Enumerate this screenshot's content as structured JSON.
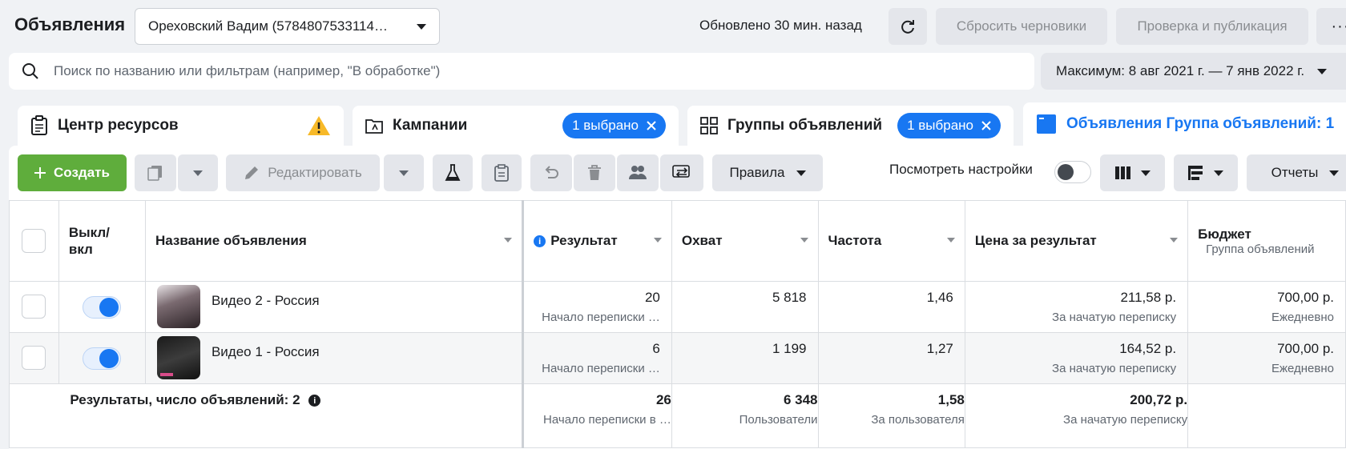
{
  "header": {
    "title": "Объявления",
    "account": "Ореховский Вадим (5784807533114…",
    "updated": "Обновлено 30 мин. назад",
    "reset_label": "Сбросить черновики",
    "publish_label": "Проверка и публикация",
    "more_label": "···"
  },
  "search": {
    "placeholder": "Поиск по названию или фильтрам (например, \"В обработке\")",
    "date_range": "Максимум: 8 авг 2021 г. — 7 янв 2022 г."
  },
  "tabs": [
    {
      "label": "Центр ресурсов"
    },
    {
      "label": "Кампании",
      "chip": "1 выбрано"
    },
    {
      "label": "Группы объявлений",
      "chip": "1 выбрано"
    },
    {
      "label": "Объявления Группа объявлений: 1"
    }
  ],
  "toolbar": {
    "create_label": "Создать",
    "edit_label": "Редактировать",
    "rules_label": "Правила",
    "view_settings_label": "Посмотреть настройки",
    "reports_label": "Отчеты"
  },
  "table": {
    "columns": {
      "toggle": "Выкл/ вкл",
      "name": "Название объявления",
      "result": "Результат",
      "reach": "Охват",
      "frequency": "Частота",
      "cost_per_result": "Цена за результат",
      "budget": "Бюджет",
      "budget_sub": "Группа объявлений"
    },
    "rows": [
      {
        "name": "Видео 2 - Россия",
        "result": "20",
        "result_sub": "Начало переписки …",
        "reach": "5 818",
        "frequency": "1,46",
        "cost": "211,58 р.",
        "cost_sub": "За начатую переписку",
        "budget": "700,00 р.",
        "budget_sub": "Ежедневно"
      },
      {
        "name": "Видео 1 - Россия",
        "result": "6",
        "result_sub": "Начало переписки …",
        "reach": "1 199",
        "frequency": "1,27",
        "cost": "164,52 р.",
        "cost_sub": "За начатую переписку",
        "budget": "700,00 р.",
        "budget_sub": "Ежедневно"
      }
    ],
    "summary": {
      "label": "Результаты, число объявлений: 2",
      "result": "26",
      "result_sub": "Начало переписки в …",
      "reach": "6 348",
      "reach_sub": "Пользователи",
      "frequency": "1,58",
      "frequency_sub": "За пользователя",
      "cost": "200,72 р.",
      "cost_sub": "За начатую переписку"
    }
  },
  "colors": {
    "accent": "#1877f2",
    "create_green": "#5fad3c",
    "warning": "#f7b928"
  }
}
